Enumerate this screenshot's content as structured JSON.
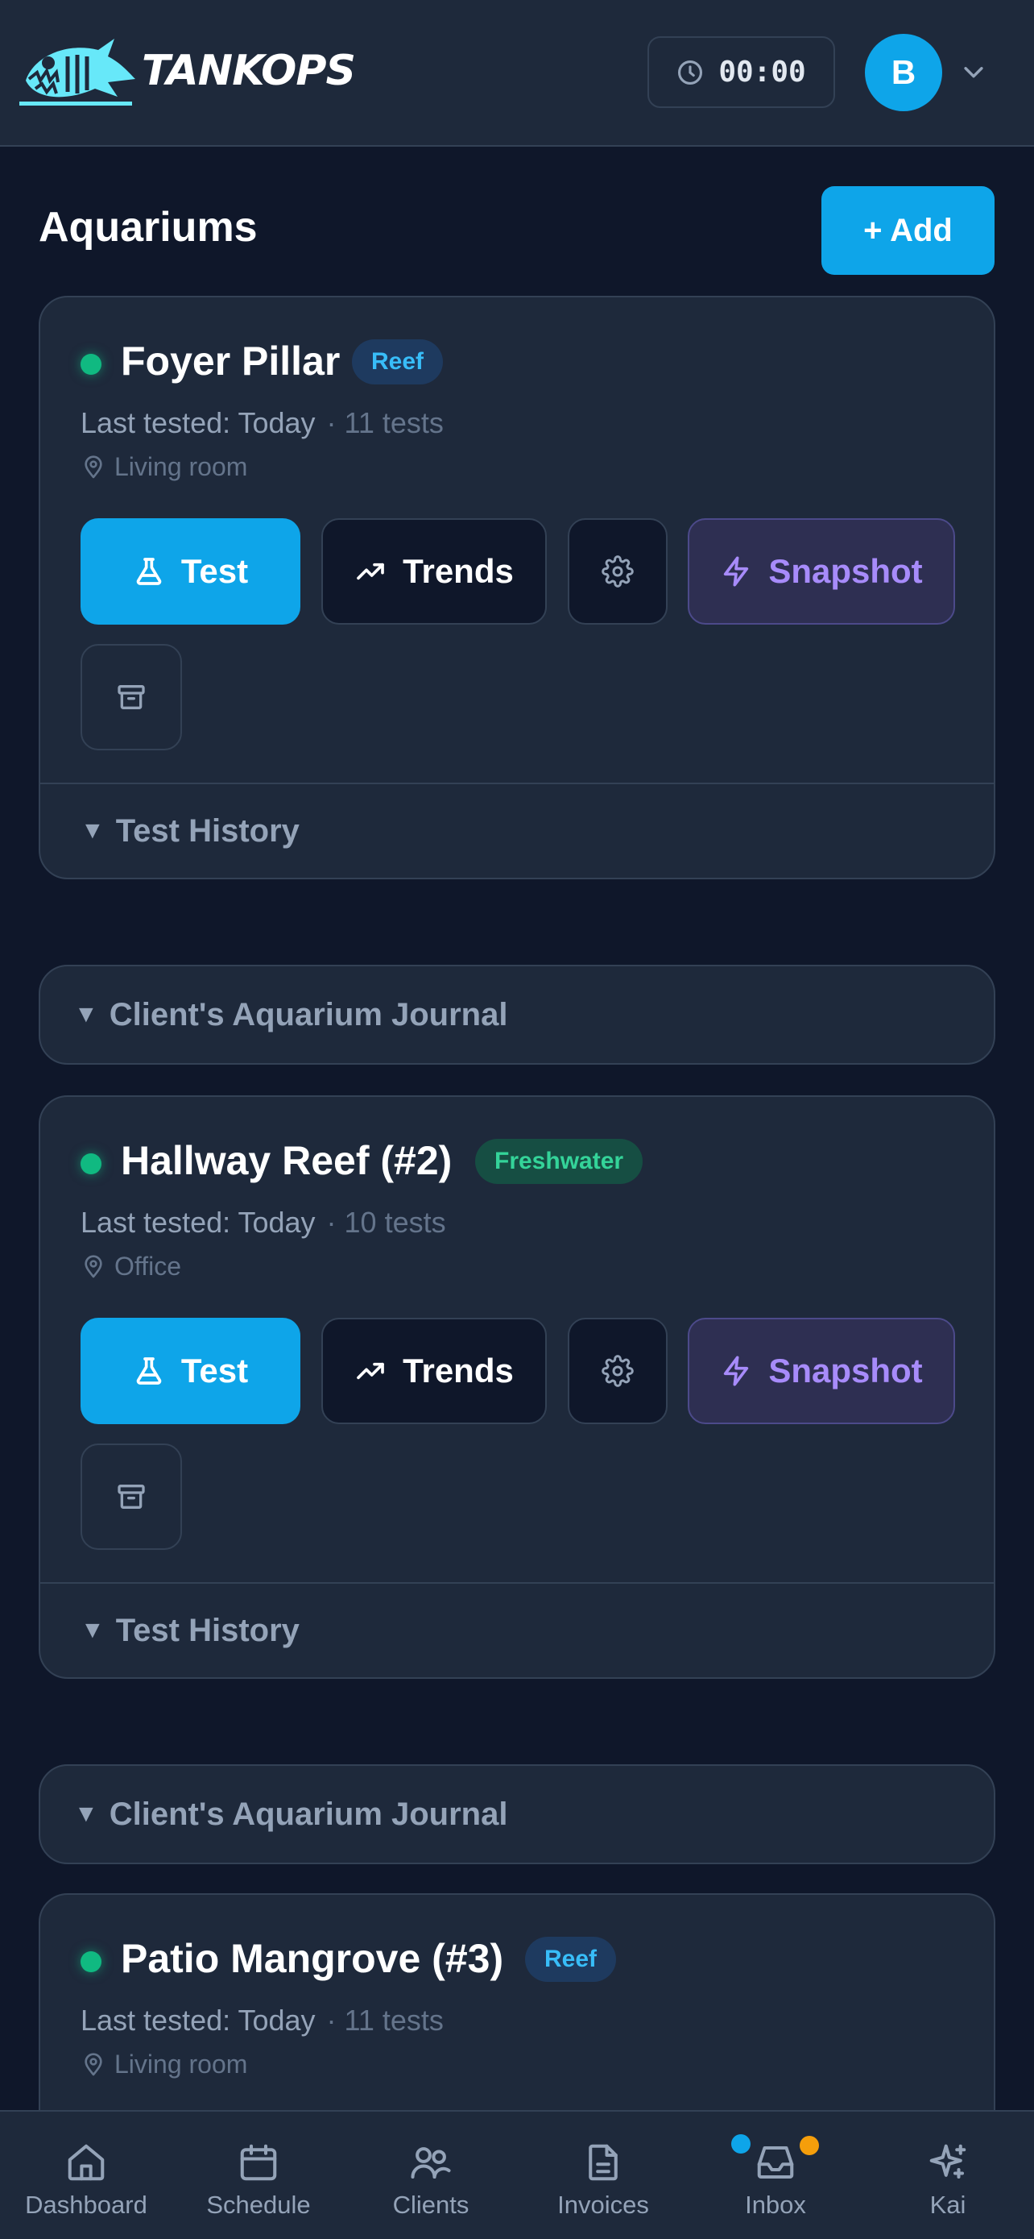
{
  "app": {
    "brand": "TANKOPS"
  },
  "header": {
    "timer": "00:00",
    "avatar_initial": "B"
  },
  "page": {
    "title": "Aquariums",
    "add_label": "+ Add"
  },
  "buttons": {
    "test": "Test",
    "trends": "Trends",
    "snapshot": "Snapshot",
    "test_history": "Test History",
    "journal": "Client's Aquarium Journal"
  },
  "aquariums": [
    {
      "name": "Foyer Pillar",
      "type": "Reef",
      "last_tested": "Last tested: Today",
      "test_count": "· 11 tests",
      "location": "Living room"
    },
    {
      "name": "Hallway Reef (#2)",
      "type": "Freshwater",
      "last_tested": "Last tested: Today",
      "test_count": "· 10 tests",
      "location": "Office"
    },
    {
      "name": "Patio Mangrove (#3)",
      "type": "Reef",
      "last_tested": "Last tested: Today",
      "test_count": "· 11 tests",
      "location": "Living room"
    }
  ],
  "nav": {
    "items": [
      {
        "label": "Dashboard",
        "icon": "home-icon"
      },
      {
        "label": "Schedule",
        "icon": "calendar-icon"
      },
      {
        "label": "Clients",
        "icon": "users-icon"
      },
      {
        "label": "Invoices",
        "icon": "document-icon"
      },
      {
        "label": "Inbox",
        "icon": "inbox-icon"
      },
      {
        "label": "Kai",
        "icon": "sparkles-icon"
      }
    ]
  },
  "colors": {
    "background": "#0f172a",
    "surface": "#1e293b",
    "accent": "#0ea5e9",
    "status_ok": "#10b981",
    "snapshot": "#a78bfa",
    "inbox_dot_blue": "#0ea5e9",
    "inbox_dot_orange": "#f59e0b"
  }
}
